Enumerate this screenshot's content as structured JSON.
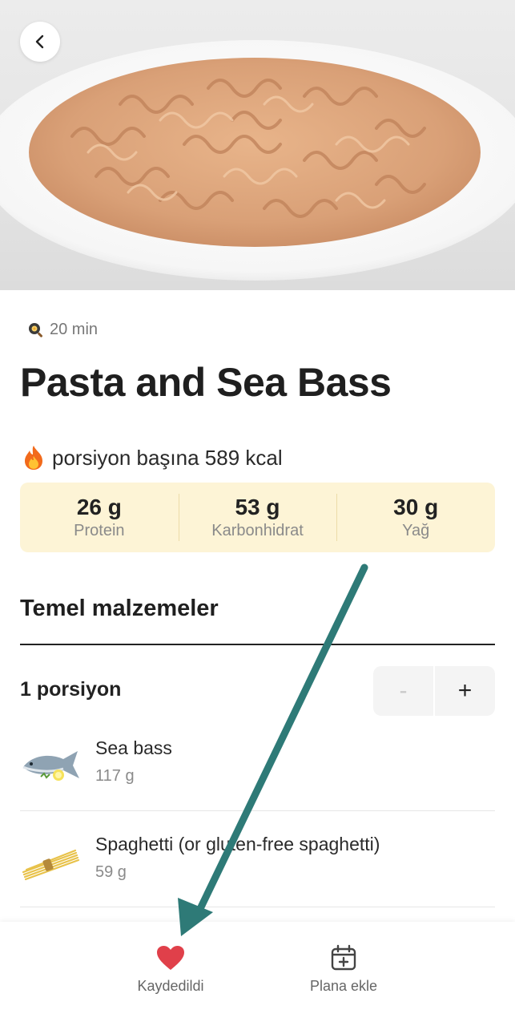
{
  "recipe": {
    "time": "20 min",
    "title": "Pasta and Sea Bass",
    "kcal_text": "porsiyon başına 589 kcal"
  },
  "macros": [
    {
      "value": "26 g",
      "label": "Protein"
    },
    {
      "value": "53 g",
      "label": "Karbonhidrat"
    },
    {
      "value": "30 g",
      "label": "Yağ"
    }
  ],
  "ingredients_section": {
    "title": "Temel malzemeler",
    "portion_label": "1 porsiyon",
    "minus": "-",
    "plus": "+"
  },
  "ingredients": [
    {
      "name": "Sea bass",
      "amount": "117 g",
      "icon": "fish-icon"
    },
    {
      "name": "Spaghetti (or gluten-free spaghetti)",
      "amount": "59 g",
      "icon": "spaghetti-icon"
    }
  ],
  "bottom_bar": {
    "saved_label": "Kaydedildi",
    "plan_label": "Plana ekle"
  },
  "colors": {
    "macro_bg": "#fdf4d6",
    "heart": "#e0404a",
    "annotation_arrow": "#2e7a77"
  }
}
